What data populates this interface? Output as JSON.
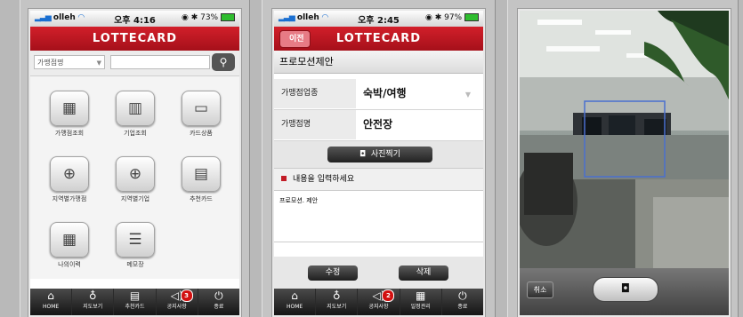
{
  "screen1": {
    "carrier": "olleh",
    "time": "오후 4:16",
    "battery": "73%",
    "brand": "LOTTECARD",
    "search_select": "가맹점명",
    "search_placeholder": "",
    "menu": [
      {
        "label": "가맹점조회",
        "icon": "store-icon"
      },
      {
        "label": "기업조회",
        "icon": "company-search-icon"
      },
      {
        "label": "카드상품",
        "icon": "card-icon"
      },
      {
        "label": "지역별가맹점",
        "icon": "region-store-icon"
      },
      {
        "label": "지역별기업",
        "icon": "region-company-icon"
      },
      {
        "label": "추천카드",
        "icon": "recommend-card-icon"
      },
      {
        "label": "나의이력",
        "icon": "calendar-icon"
      },
      {
        "label": "메모장",
        "icon": "memo-icon"
      }
    ],
    "tabs": [
      {
        "label": "HOME",
        "icon": "home-icon"
      },
      {
        "label": "지도보기",
        "icon": "map-pin-icon"
      },
      {
        "label": "추천카드",
        "icon": "card-icon"
      },
      {
        "label": "공지사항",
        "icon": "speaker-icon",
        "badge": "3"
      },
      {
        "label": "종료",
        "icon": "power-icon"
      }
    ]
  },
  "screen2": {
    "carrier": "olleh",
    "time": "오후 2:45",
    "battery": "97%",
    "back_label": "이전",
    "brand": "LOTTECARD",
    "subtitle": "프로모션제안",
    "field1_label": "가맹점업종",
    "field1_value": "숙박/여행",
    "field2_label": "가맹점명",
    "field2_value": "안전장",
    "photo_label": "사진찍기",
    "notice": "내용을 입력하세요",
    "content": "프로모션. 제안",
    "edit_label": "수정",
    "delete_label": "삭제",
    "tabs": [
      {
        "label": "HOME",
        "icon": "home-icon"
      },
      {
        "label": "지도보기",
        "icon": "map-pin-icon"
      },
      {
        "label": "공지사항",
        "icon": "speaker-icon",
        "badge": "2"
      },
      {
        "label": "일정관리",
        "icon": "schedule-icon"
      },
      {
        "label": "종료",
        "icon": "power-icon"
      }
    ]
  },
  "screen3": {
    "cancel_label": "취소",
    "shutter_icon": "camera-icon"
  }
}
